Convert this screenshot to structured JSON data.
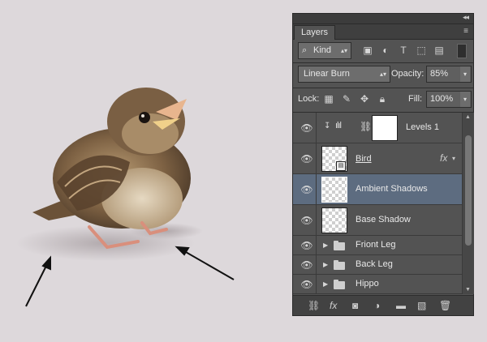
{
  "panel": {
    "tab_label": "Layers",
    "collapse_glyph": "◂◂",
    "menu_glyph": "≡",
    "filter": {
      "label": "Kind",
      "search_glyph": "⌕"
    },
    "blend_mode": "Linear Burn",
    "opacity_label": "Opacity:",
    "opacity_value": "85%",
    "lock_label": "Lock:",
    "fill_label": "Fill:",
    "fill_value": "100%",
    "layers": [
      {
        "name": "Levels 1",
        "type": "adjustment",
        "selected": false
      },
      {
        "name": "Bird",
        "type": "smart",
        "selected": false,
        "fx": "fx"
      },
      {
        "name": "Ambient Shadows",
        "type": "pixel",
        "selected": true
      },
      {
        "name": "Base Shadow",
        "type": "pixel",
        "selected": false
      },
      {
        "name": "Friont Leg",
        "type": "group",
        "selected": false
      },
      {
        "name": "Back Leg",
        "type": "group",
        "selected": false
      },
      {
        "name": "Hippo",
        "type": "group",
        "selected": false
      }
    ]
  },
  "colors": {
    "panel_bg": "#535353",
    "selected_row": "#5d6c80",
    "canvas_bg": "#ddd8db"
  }
}
